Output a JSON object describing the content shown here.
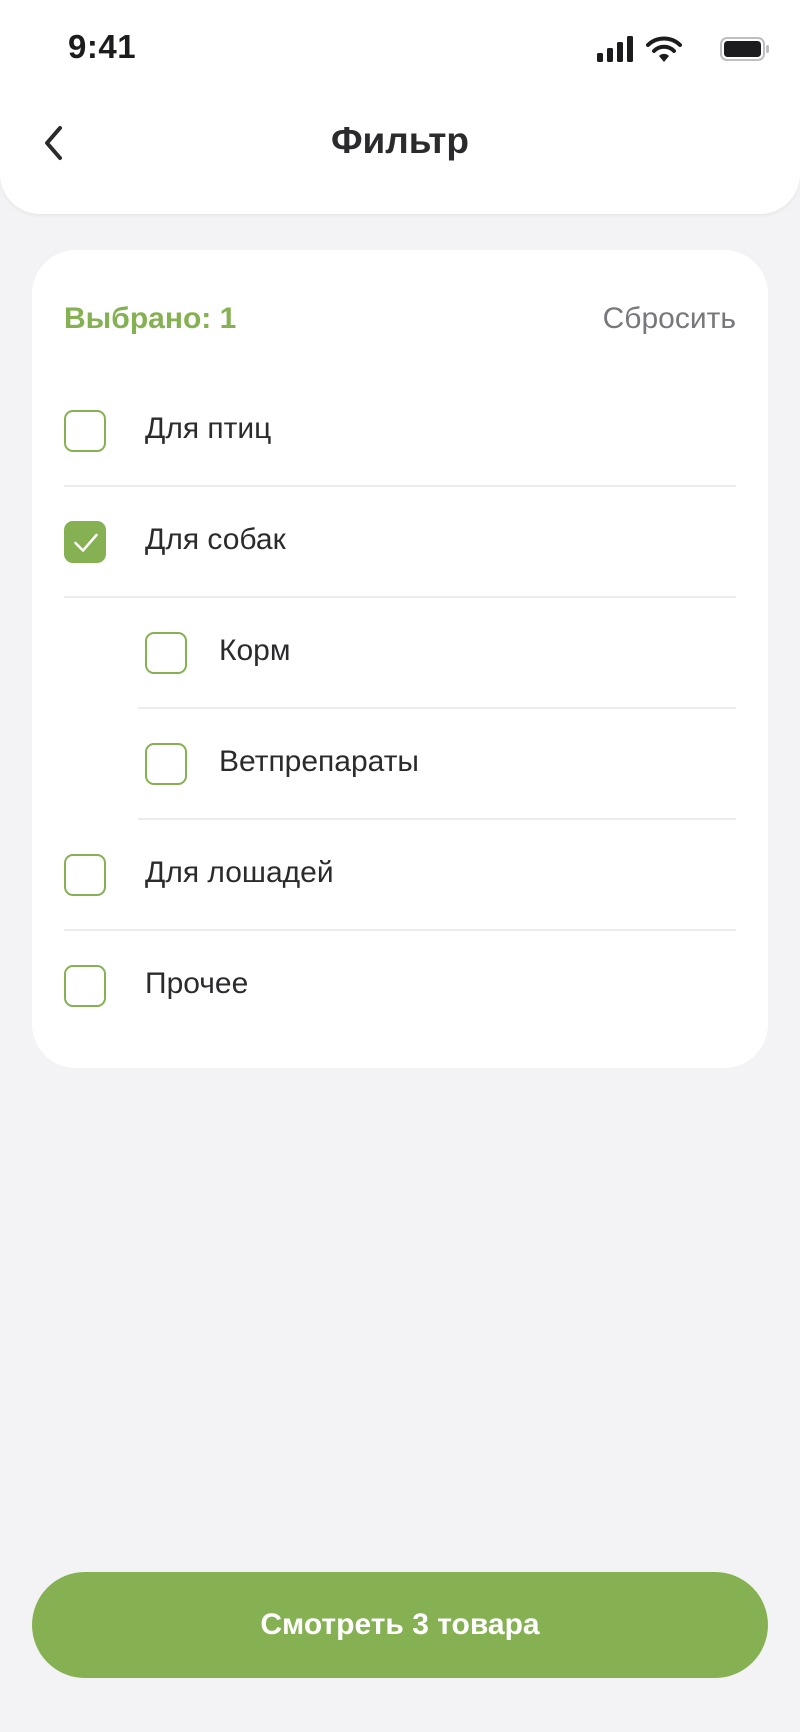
{
  "status_bar": {
    "time": "9:41"
  },
  "header": {
    "title": "Фильтр"
  },
  "filter": {
    "selected_label": "Выбрано: 1",
    "reset_label": "Сбросить",
    "items": [
      {
        "label": "Для птиц",
        "checked": false,
        "level": 0
      },
      {
        "label": "Для собак",
        "checked": true,
        "level": 0
      },
      {
        "label": "Корм",
        "checked": false,
        "level": 1
      },
      {
        "label": "Ветпрепараты",
        "checked": false,
        "level": 1
      },
      {
        "label": "Для лошадей",
        "checked": false,
        "level": 0
      },
      {
        "label": "Прочее",
        "checked": false,
        "level": 0
      }
    ]
  },
  "cta": {
    "label": "Смотреть 3 товара"
  },
  "colors": {
    "accent": "#86B153",
    "background": "#F3F3F5",
    "text": "#2B2B2E",
    "muted": "#77777C"
  }
}
